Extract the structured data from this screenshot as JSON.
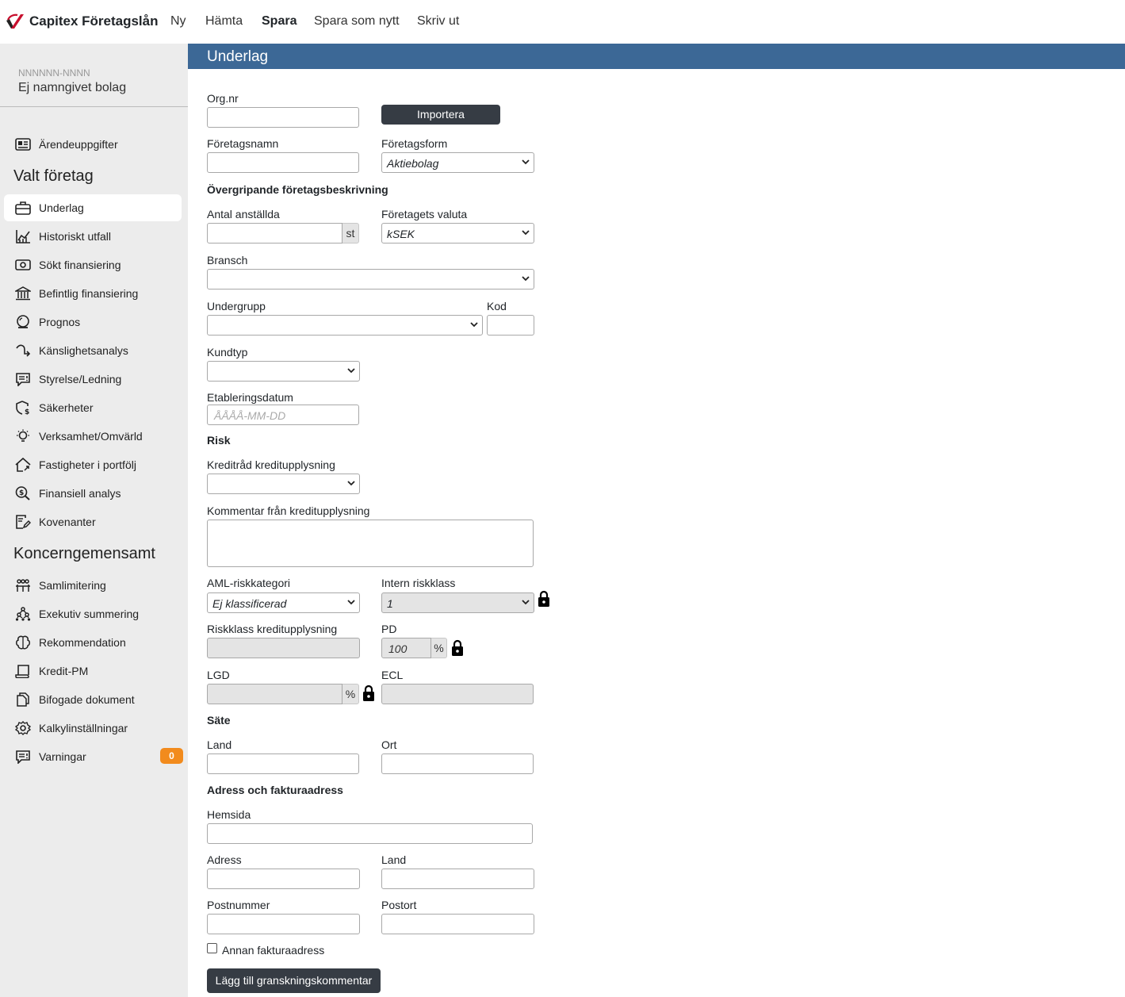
{
  "app": {
    "brand": "Capitex Företagslån"
  },
  "menu": {
    "new": "Ny",
    "fetch": "Hämta",
    "save": "Spara",
    "save_as_new": "Spara som nytt",
    "print": "Skriv ut"
  },
  "company": {
    "id": "NNNNNN-NNNN",
    "name": "Ej namngivet bolag"
  },
  "sidebar": {
    "top_item": "Ärendeuppgifter",
    "section1": "Valt företag",
    "items1": [
      "Underlag",
      "Historiskt utfall",
      "Sökt finansiering",
      "Befintlig finansiering",
      "Prognos",
      "Känslighetsanalys",
      "Styrelse/Ledning",
      "Säkerheter",
      "Verksamhet/Omvärld",
      "Fastigheter i portfölj",
      "Finansiell analys",
      "Kovenanter"
    ],
    "section2": "Koncerngemensamt",
    "items2": [
      "Samlimitering",
      "Exekutiv summering",
      "Rekommendation",
      "Kredit-PM",
      "Bifogade dokument",
      "Kalkylinställningar",
      "Varningar"
    ],
    "warnings_count": "0"
  },
  "page": {
    "title": "Underlag"
  },
  "form": {
    "org_nr": "Org.nr",
    "import": "Importera",
    "company_name": "Företagsnamn",
    "company_form": "Företagsform",
    "company_form_value": "Aktiebolag",
    "section_overview": "Övergripande företagsbeskrivning",
    "employees": "Antal anställda",
    "employees_unit": "st",
    "currency": "Företagets valuta",
    "currency_value": "kSEK",
    "industry": "Bransch",
    "subgroup": "Undergrupp",
    "code": "Kod",
    "customer_type": "Kundtyp",
    "established": "Etableringsdatum",
    "established_placeholder": "ÅÅÅÅ-MM-DD",
    "section_risk": "Risk",
    "credit_advice": "Kreditråd kreditupplysning",
    "credit_comment": "Kommentar från kreditupplysning",
    "aml": "AML-riskkategori",
    "aml_value": "Ej klassificerad",
    "internal_risk": "Intern riskklass",
    "internal_risk_value": "1",
    "risk_class_credit": "Riskklass kreditupplysning",
    "pd": "PD",
    "pd_value": "100",
    "pct": "%",
    "lgd": "LGD",
    "ecl": "ECL",
    "section_seat": "Säte",
    "country": "Land",
    "city": "Ort",
    "section_address": "Adress och fakturaadress",
    "website": "Hemsida",
    "address": "Adress",
    "country2": "Land",
    "postal_code": "Postnummer",
    "postal_city": "Postort",
    "other_invoice": "Annan fakturaadress",
    "review_button": "Lägg till granskningskommentar"
  }
}
